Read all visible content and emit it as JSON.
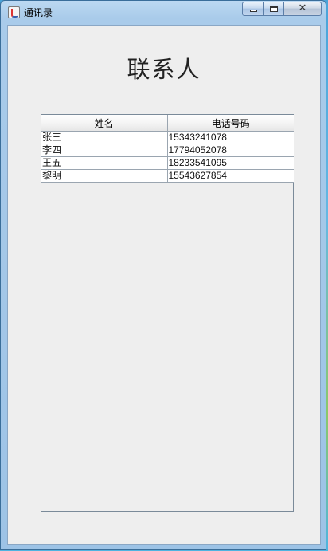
{
  "window": {
    "title": "通讯录",
    "controls": {
      "minimize": "minimize",
      "maximize": "maximize",
      "close": "close"
    }
  },
  "main": {
    "heading": "联系人"
  },
  "table": {
    "columns": [
      "姓名",
      "电话号码"
    ],
    "rows": [
      [
        "张三",
        "15343241078"
      ],
      [
        "李四",
        "17794052078"
      ],
      [
        "王五",
        "18233541095"
      ],
      [
        "黎明",
        "15543627854"
      ]
    ]
  }
}
